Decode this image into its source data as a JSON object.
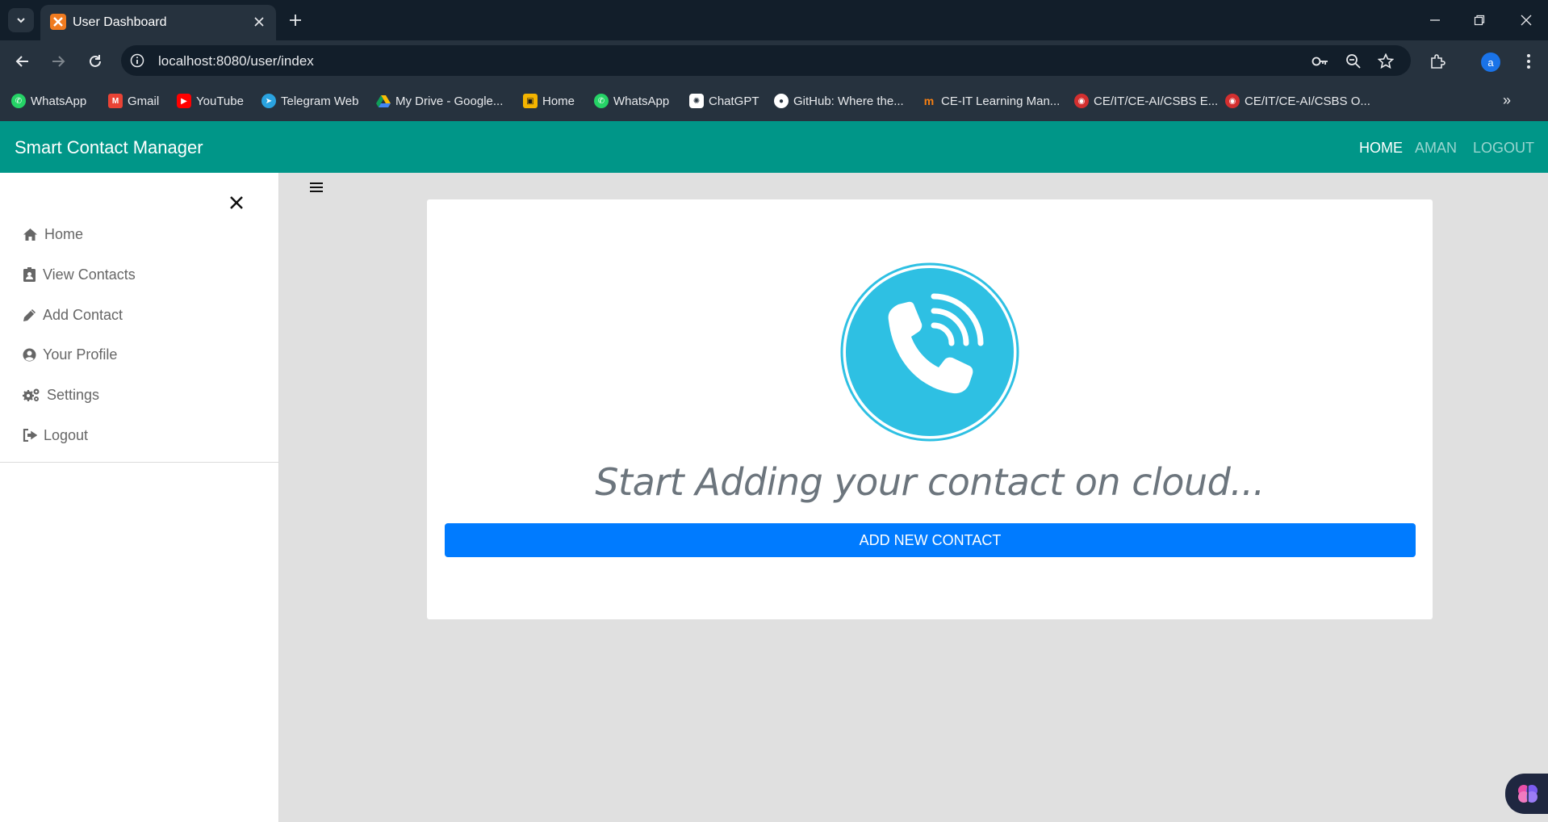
{
  "browser": {
    "tab_title": "User Dashboard",
    "url": "localhost:8080/user/index",
    "profile_initial": "a",
    "bookmarks": [
      {
        "label": "WhatsApp",
        "icon": "whatsapp-icon",
        "color": "#25d366"
      },
      {
        "label": "Gmail",
        "icon": "gmail-icon",
        "color": "#ea4335"
      },
      {
        "label": "YouTube",
        "icon": "youtube-icon",
        "color": "#ff0000"
      },
      {
        "label": "Telegram Web",
        "icon": "telegram-icon",
        "color": "#2aa3e0"
      },
      {
        "label": "My Drive - Google...",
        "icon": "google-drive-icon",
        "color": "#34a853"
      },
      {
        "label": "Home",
        "icon": "home-folder-icon",
        "color": "#f4b400"
      },
      {
        "label": "WhatsApp",
        "icon": "whatsapp-icon",
        "color": "#25d366"
      },
      {
        "label": "ChatGPT",
        "icon": "chatgpt-icon",
        "color": "#ffffff"
      },
      {
        "label": "GitHub: Where the...",
        "icon": "github-icon",
        "color": "#ffffff"
      },
      {
        "label": "CE-IT Learning Man...",
        "icon": "moodle-icon",
        "color": "#f98012"
      },
      {
        "label": "CE/IT/CE-AI/CSBS E...",
        "icon": "university-icon",
        "color": "#d32f2f"
      },
      {
        "label": "CE/IT/CE-AI/CSBS O...",
        "icon": "university-icon",
        "color": "#d32f2f"
      }
    ]
  },
  "app": {
    "brand": "Smart Contact Manager",
    "nav": {
      "home": "Home",
      "user": "Aman",
      "logout": "Logout"
    },
    "sidebar": [
      {
        "label": "Home",
        "icon": "home-icon"
      },
      {
        "label": "View Contacts",
        "icon": "address-card-icon"
      },
      {
        "label": "Add Contact",
        "icon": "pencil-icon"
      },
      {
        "label": "Your Profile",
        "icon": "user-circle-icon"
      },
      {
        "label": "Settings",
        "icon": "gears-icon"
      },
      {
        "label": "Logout",
        "icon": "sign-out-icon"
      }
    ],
    "main": {
      "tagline": "Start Adding your contact on cloud...",
      "button": "Add New Contact"
    },
    "colors": {
      "navbar": "#009688",
      "button": "#007bff",
      "logo": "#2ec0e3"
    }
  }
}
